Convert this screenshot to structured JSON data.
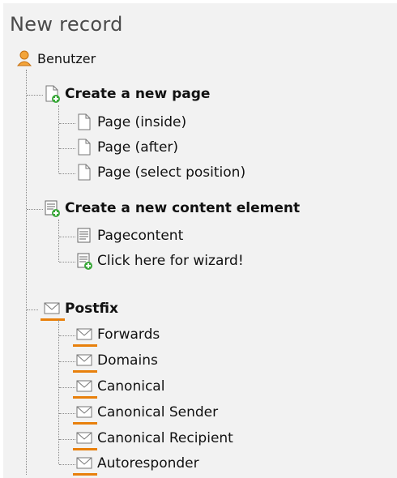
{
  "header": {
    "title": "New record"
  },
  "root": {
    "label": "Benutzer",
    "icon": "user-icon"
  },
  "sections": [
    {
      "label": "Create a new page",
      "icon": "new-page-icon",
      "items": [
        {
          "label": "Page (inside)",
          "icon": "page-icon"
        },
        {
          "label": "Page (after)",
          "icon": "page-icon"
        },
        {
          "label": "Page (select position)",
          "icon": "page-icon"
        }
      ]
    },
    {
      "label": "Create a new content element",
      "icon": "new-content-element-icon",
      "items": [
        {
          "label": "Pagecontent",
          "icon": "content-icon"
        },
        {
          "label": "Click here for wizard!",
          "icon": "wizard-icon"
        }
      ]
    },
    {
      "label": "Postfix",
      "icon": "mail-icon",
      "items": [
        {
          "label": "Forwards",
          "icon": "mail-icon"
        },
        {
          "label": "Domains",
          "icon": "mail-icon"
        },
        {
          "label": "Canonical",
          "icon": "mail-icon"
        },
        {
          "label": "Canonical Sender",
          "icon": "mail-icon"
        },
        {
          "label": "Canonical Recipient",
          "icon": "mail-icon"
        },
        {
          "label": "Autoresponder",
          "icon": "mail-icon"
        }
      ]
    }
  ],
  "colors": {
    "accent": "#e8800c",
    "user": "#f0a030",
    "new_badge": "#3aa83a"
  }
}
